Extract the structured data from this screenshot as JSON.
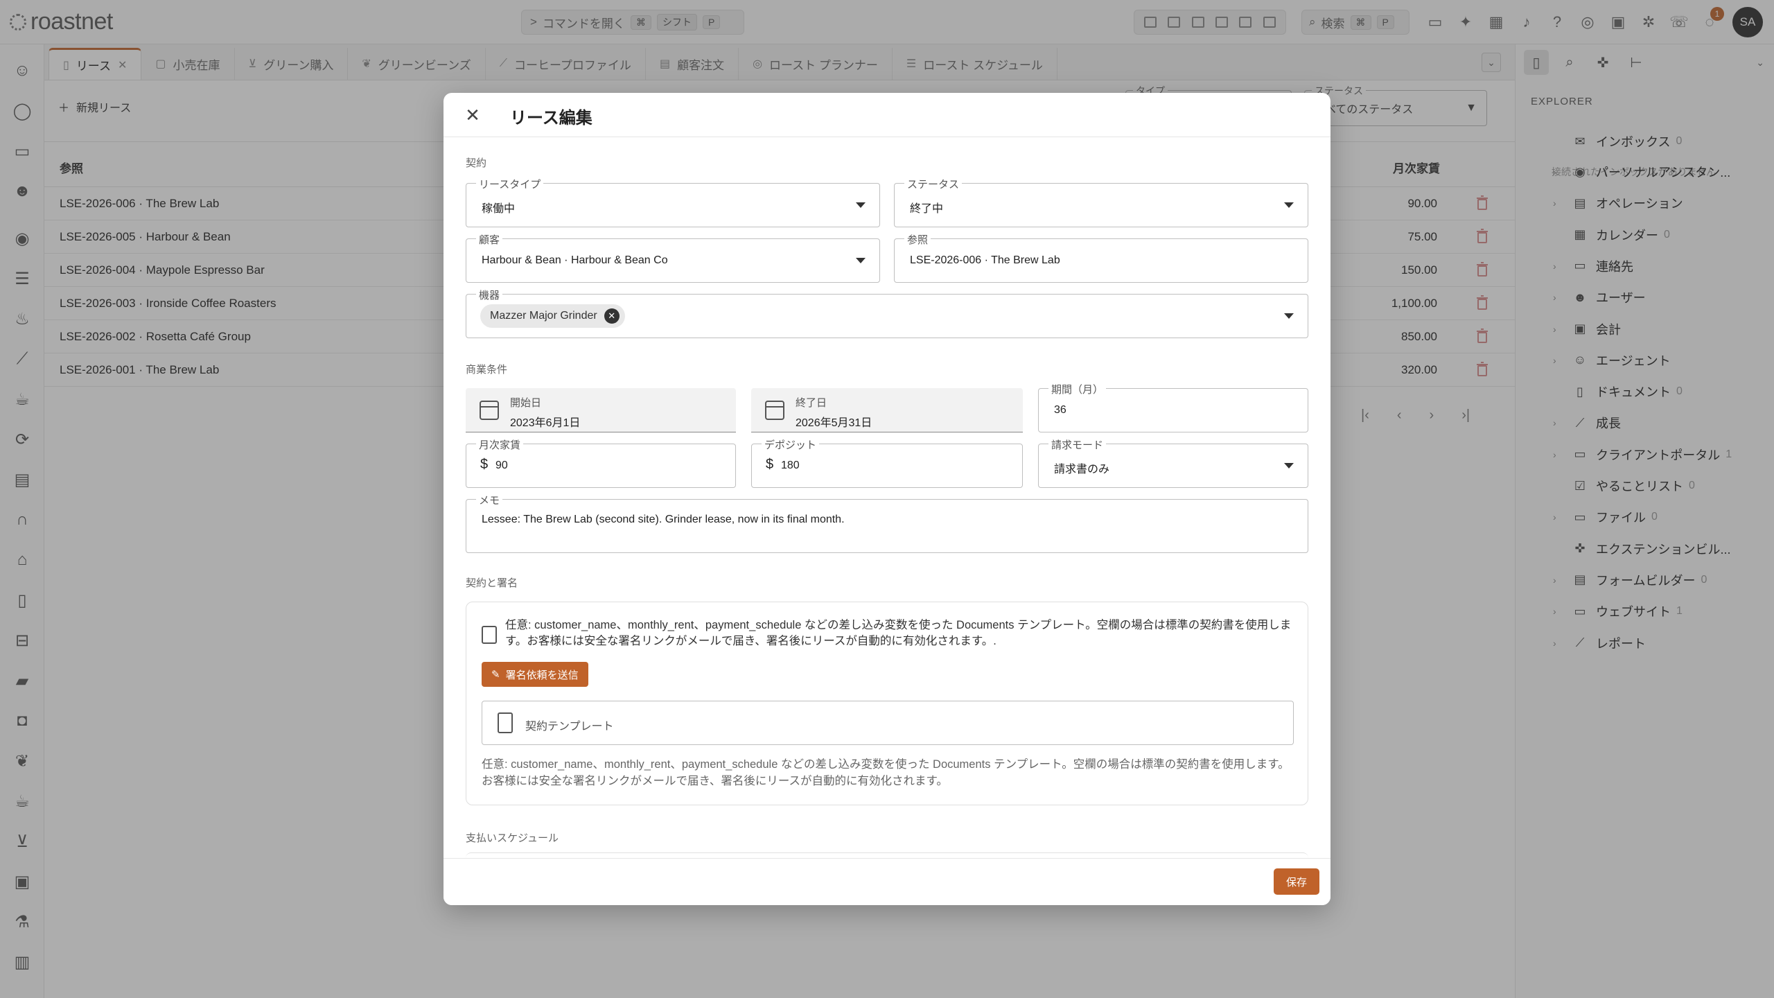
{
  "app": {
    "brand": "roastnet",
    "accent": "#c0622a"
  },
  "topbar": {
    "command_label": "コマンドを開く",
    "command_keys": [
      "⌘",
      "シフト",
      "P"
    ],
    "search_label": "検索",
    "search_keys": [
      "⌘",
      "P"
    ],
    "notification_count": "1",
    "avatar_initials": "SA"
  },
  "tabs": [
    {
      "label": "リース",
      "icon": "document-icon",
      "active": true
    },
    {
      "label": "小売在庫",
      "icon": "box-icon"
    },
    {
      "label": "グリーン購入",
      "icon": "cart-icon"
    },
    {
      "label": "グリーンビーンズ",
      "icon": "sprout-icon"
    },
    {
      "label": "コーヒープロファイル",
      "icon": "chart-icon"
    },
    {
      "label": "顧客注文",
      "icon": "receipt-icon"
    },
    {
      "label": "ロースト プランナー",
      "icon": "flame-icon"
    },
    {
      "label": "ロースト スケジュール",
      "icon": "list-icon"
    }
  ],
  "main": {
    "new_button": "新規リース",
    "filter_type_label": "タイプ",
    "filter_status_label": "ステータス",
    "filter_status_value": "すべてのステータス",
    "columns": {
      "reference": "参照",
      "monthly_rent": "月次家賃"
    },
    "rows": [
      {
        "ref": "LSE-2026-006 · The Brew Lab",
        "rent": "90.00"
      },
      {
        "ref": "LSE-2026-005 · Harbour & Bean",
        "rent": "75.00"
      },
      {
        "ref": "LSE-2026-004 · Maypole Espresso Bar",
        "rent": "150.00"
      },
      {
        "ref": "LSE-2026-003 · Ironside Coffee Roasters",
        "rent": "1,100.00"
      },
      {
        "ref": "LSE-2026-002 · Rosetta Café Group",
        "rent": "850.00"
      },
      {
        "ref": "LSE-2026-001 · The Brew Lab",
        "rent": "320.00"
      }
    ]
  },
  "explorer": {
    "title": "EXPLORER",
    "no_inbox_note": "接続されたインボックスがありません",
    "items": [
      {
        "label": "インボックス",
        "count": "0",
        "icon": "mail-icon",
        "caret": false
      },
      {
        "label": "パーソナルアシスタン...",
        "count": "",
        "icon": "assistant-icon",
        "caret": true
      },
      {
        "label": "オペレーション",
        "count": "",
        "icon": "operations-icon",
        "caret": true
      },
      {
        "label": "カレンダー",
        "count": "0",
        "icon": "calendar-icon",
        "caret": false
      },
      {
        "label": "連絡先",
        "count": "",
        "icon": "contact-card-icon",
        "caret": true
      },
      {
        "label": "ユーザー",
        "count": "",
        "icon": "users-icon",
        "caret": true
      },
      {
        "label": "会計",
        "count": "",
        "icon": "ledger-icon",
        "caret": true
      },
      {
        "label": "エージェント",
        "count": "",
        "icon": "agent-icon",
        "caret": true
      },
      {
        "label": "ドキュメント",
        "count": "0",
        "icon": "document-icon",
        "caret": false
      },
      {
        "label": "成長",
        "count": "",
        "icon": "growth-icon",
        "caret": true
      },
      {
        "label": "クライアントポータル",
        "count": "1",
        "icon": "portal-icon",
        "caret": true
      },
      {
        "label": "やることリスト",
        "count": "0",
        "icon": "todo-icon",
        "caret": false
      },
      {
        "label": "ファイル",
        "count": "0",
        "icon": "folder-icon",
        "caret": true
      },
      {
        "label": "エクステンションビル...",
        "count": "",
        "icon": "extension-icon",
        "caret": false
      },
      {
        "label": "フォームビルダー",
        "count": "0",
        "icon": "form-icon",
        "caret": true
      },
      {
        "label": "ウェブサイト",
        "count": "1",
        "icon": "website-icon",
        "caret": true
      },
      {
        "label": "レポート",
        "count": "",
        "icon": "report-icon",
        "caret": true
      }
    ]
  },
  "modal": {
    "title": "リース編集",
    "sections": {
      "contract": "契約",
      "terms": "商業条件",
      "signing": "契約と署名",
      "payments": "支払いスケジュール"
    },
    "lease_type": {
      "label": "リースタイプ",
      "value": "稼働中"
    },
    "status": {
      "label": "ステータス",
      "value": "終了中"
    },
    "customer": {
      "label": "顧客",
      "value": "Harbour & Bean · Harbour & Bean Co"
    },
    "reference": {
      "label": "参照",
      "value": "LSE-2026-006 · The Brew Lab"
    },
    "equipment": {
      "label": "機器",
      "chip": "Mazzer Major Grinder"
    },
    "start_date": {
      "label": "開始日",
      "value": "2023年6月1日"
    },
    "end_date": {
      "label": "終了日",
      "value": "2026年5月31日"
    },
    "term": {
      "label": "期間（月）",
      "value": "36"
    },
    "monthly_rent": {
      "label": "月次家賃",
      "prefix": "$",
      "value": "90"
    },
    "deposit": {
      "label": "デポジット",
      "prefix": "$",
      "value": "180"
    },
    "billing_mode": {
      "label": "請求モード",
      "value": "請求書のみ"
    },
    "memo": {
      "label": "メモ",
      "value": "Lessee: The Brew Lab (second site). Grinder lease, now in its final month."
    },
    "signing": {
      "info": "任意: customer_name、monthly_rent、payment_schedule などの差し込み変数を使った Documents テンプレート。空欄の場合は標準の契約書を使用します。お客様には安全な署名リンクがメールで届き、署名後にリースが自動的に有効化されます。.",
      "send_button": "署名依頼を送信",
      "template_placeholder": "契約テンプレート",
      "help": "任意: customer_name、monthly_rent、payment_schedule などの差し込み変数を使った Documents テンプレート。空欄の場合は標準の契約書を使用します。お客様には安全な署名リンクがメールで届き、署名後にリースが自動的に有効化されます。"
    },
    "save_button": "保存"
  }
}
